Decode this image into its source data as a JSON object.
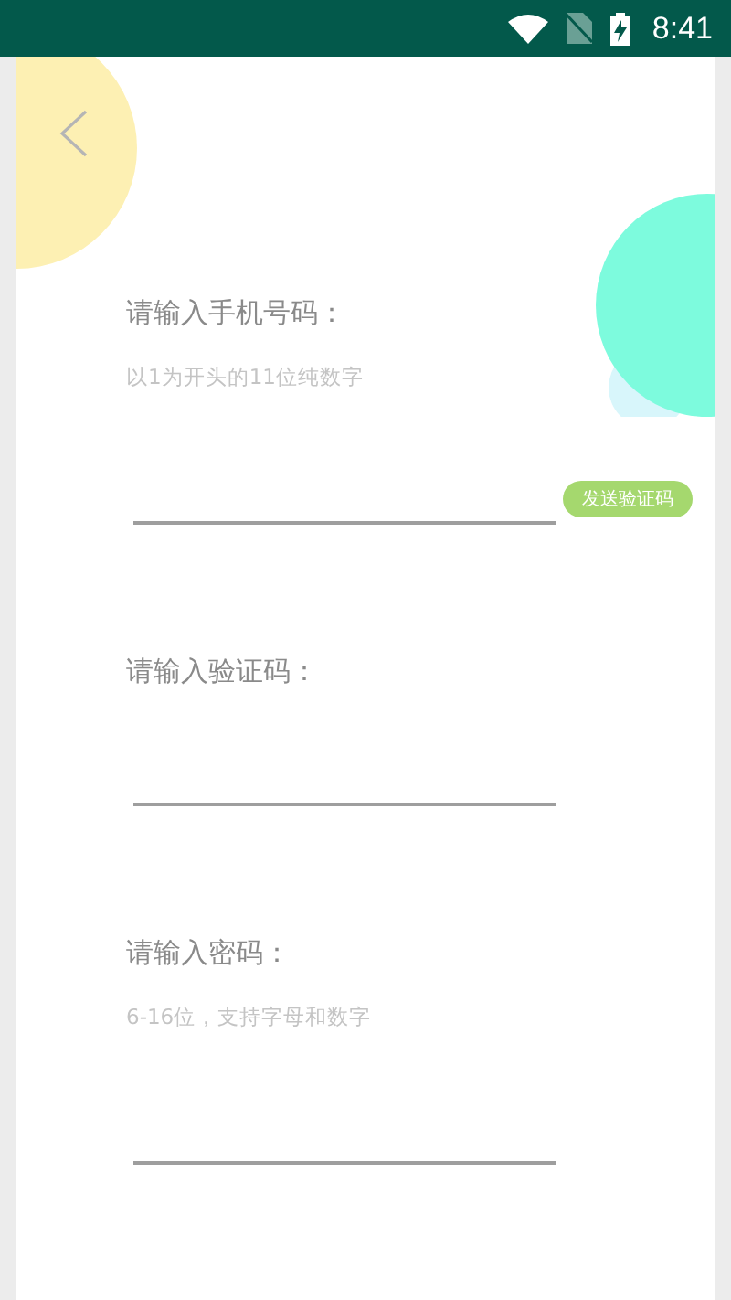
{
  "status_bar": {
    "time": "8:41"
  },
  "fields": [
    {
      "label": "请输入手机号码：",
      "hint": "以1为开头的11位纯数字",
      "action": "发送验证码"
    },
    {
      "label": "请输入验证码："
    },
    {
      "label": "请输入密码：",
      "hint": "6-16位，支持字母和数字"
    }
  ]
}
